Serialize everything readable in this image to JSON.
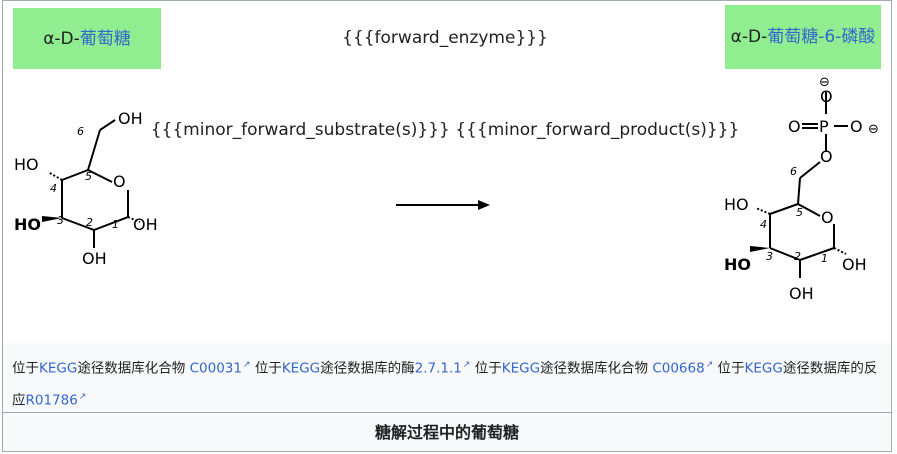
{
  "substrate": {
    "label_prefix": "α-D-",
    "label_link": "葡萄糖",
    "structure": {
      "oh_top": "OH",
      "ho_left": "HO",
      "ho_bottom_left": "HO",
      "oh_right": "OH",
      "oh_bottom": "OH",
      "ring_o": "O",
      "num6": "6",
      "num5": "5",
      "num4": "4",
      "num3": "3",
      "num2": "2",
      "num1": "1"
    }
  },
  "product": {
    "label_prefix": "α-D-",
    "label_link": "葡萄糖-6-磷酸",
    "structure": {
      "o_minus_top": "O",
      "minus_top": "⊖",
      "o_double": "O",
      "eq": "=",
      "p": "P",
      "o_right": "O",
      "minus_right": "⊖",
      "o_link": "O",
      "ring_o": "O",
      "ho_left": "HO",
      "ho_bottom_left": "HO",
      "oh_right": "OH",
      "oh_bottom": "OH",
      "num6": "6",
      "num5": "5",
      "num4": "4",
      "num3": "3",
      "num2": "2",
      "num1": "1"
    }
  },
  "enzyme_text": "{{{forward_enzyme}}}",
  "minor_text": "{{{minor_forward_substrate(s)}}} {{{minor_forward_product(s)}}}",
  "footer": {
    "seg1_prefix": "位于",
    "kegg": "KEGG",
    "seg1_suffix": "途径数据库化合物 ",
    "compound1": "C00031",
    "seg2_suffix": "途径数据库的酶",
    "enzyme": "2.7.1.1",
    "seg3_suffix": "途径数据库化合物 ",
    "compound2": "C00668",
    "seg4_suffix": "途径数据库的反应",
    "reaction": "R01786",
    "ext_icon": "external-link-icon"
  },
  "caption": "糖解过程中的葡萄糖",
  "colors": {
    "label_bg": "#90ee90",
    "link": "#3366cc",
    "border": "#a2a9b1"
  }
}
